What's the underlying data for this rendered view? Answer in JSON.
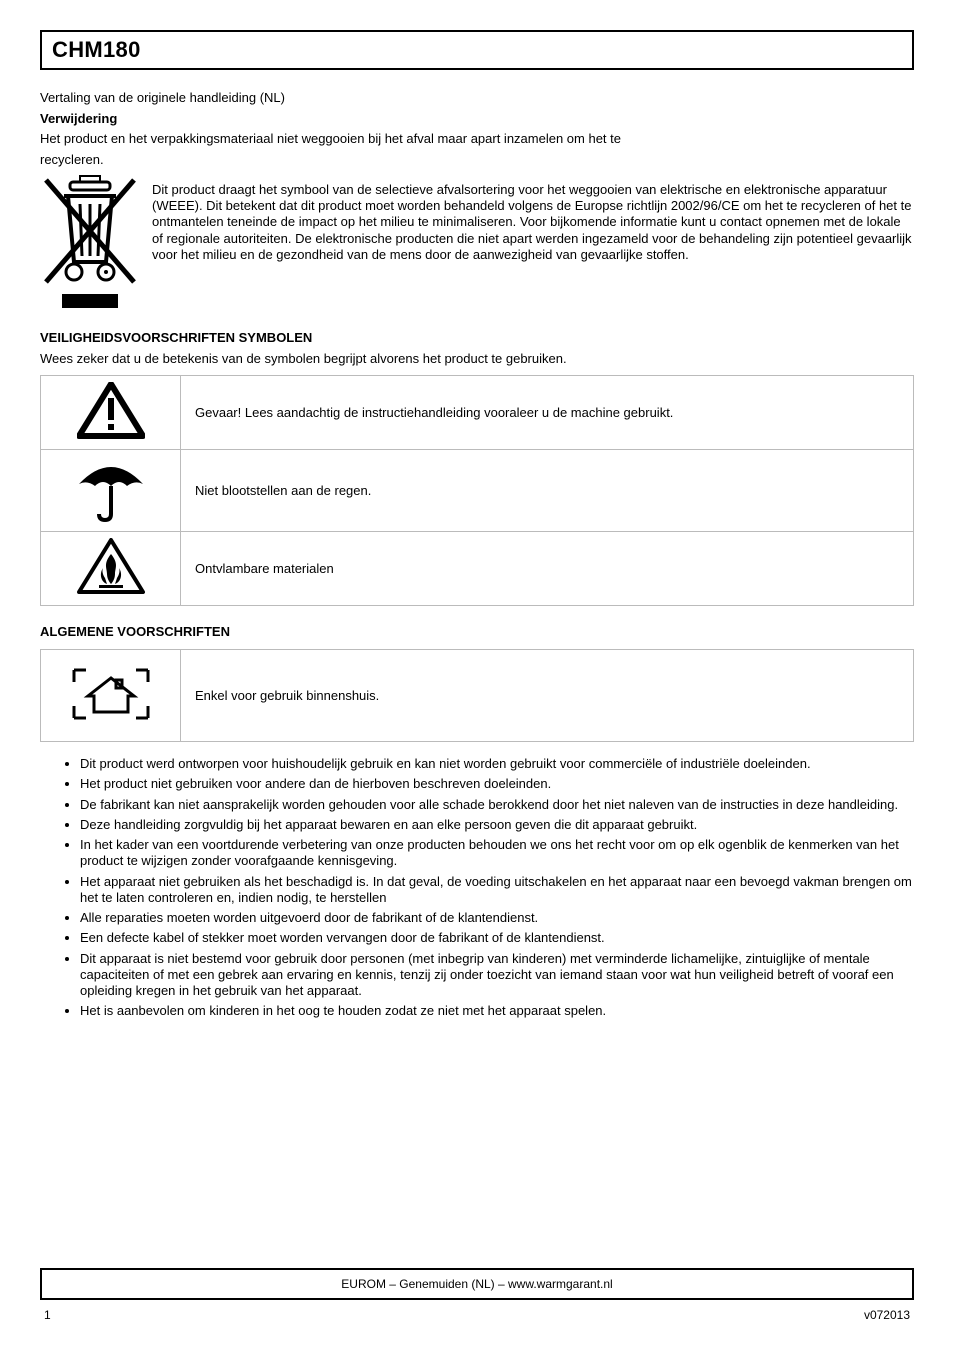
{
  "title_bar": "CHM180",
  "lang_header": "Vertaling van de originele handleiding (NL)",
  "disposal_heading": "Verwijdering",
  "disposal_line1": "Het product en het verpakkingsmateriaal niet weggooien bij het afval maar apart inzamelen om het te",
  "disposal_line2": "recycleren.",
  "disposal_para": "Dit product draagt het symbool van de selectieve afvalsortering voor het weggooien van elektrische en elektronische apparatuur (WEEE). Dit betekent dat dit product moet worden behandeld volgens de Europse richtlijn 2002/96/CE om het te recycleren of het te ontmantelen teneinde de impact op het milieu te minimaliseren. Voor bijkomende informatie kunt u contact opnemen met de lokale of regionale autoriteiten. De elektronische producten die niet apart werden ingezameld voor de behandeling zijn potentieel gevaarlijk voor het milieu en de gezondheid van de mens door de aanwezigheid van gevaarlijke stoffen.",
  "safety_heading": "VEILIGHEIDSVOORSCHRIFTEN SYMBOLEN",
  "safety_intro": "Wees zeker dat u de betekenis van de symbolen begrijpt alvorens het product te gebruiken.",
  "symbols": {
    "warning": "Gevaar! Lees aandachtig de instructiehandleiding vooraleer u de machine gebruikt.",
    "umbrella": "Niet blootstellen aan de regen.",
    "fire": "Ontvlambare materialen"
  },
  "general_heading": "ALGEMENE VOORSCHRIFTEN",
  "indoor_label": "Enkel voor gebruik binnenshuis.",
  "bullets": [
    "Dit product werd ontworpen voor huishoudelijk gebruik en kan niet worden gebruikt voor commerciële of industriële doeleinden.",
    "Het product niet gebruiken voor andere dan de hierboven beschreven doeleinden.",
    "De fabrikant kan niet aansprakelijk worden gehouden voor alle schade berokkend door het niet naleven van de instructies in deze handleiding.",
    "Deze handleiding zorgvuldig bij het apparaat bewaren en aan elke persoon geven die dit apparaat gebruikt.",
    "In het kader van een voortdurende verbetering van onze producten behouden we ons het recht voor om op elk ogenblik de kenmerken van het product te wijzigen zonder voorafgaande kennisgeving.",
    "Het apparaat niet gebruiken als het beschadigd is. In dat geval, de voeding uitschakelen en het apparaat naar een bevoegd vakman brengen om het te laten controleren en, indien nodig, te herstellen",
    "Alle reparaties moeten worden uitgevoerd door de fabrikant of de klantendienst.",
    "Een defecte kabel of stekker moet worden vervangen door de fabrikant of de klantendienst.",
    "Dit apparaat is niet bestemd voor gebruik door personen (met inbegrip van kinderen) met verminderde lichamelijke, zintuiglijke of mentale capaciteiten of met een gebrek aan ervaring en kennis, tenzij zij onder toezicht van iemand staan voor wat hun veiligheid betreft of vooraf een opleiding kregen in het gebruik van het apparaat.",
    "Het is aanbevolen om kinderen in het oog te houden zodat ze niet met het apparaat spelen."
  ],
  "footer_bar": "EUROM – Genemuiden (NL) – www.warmgarant.nl",
  "footer": {
    "left": "1",
    "right": "v072013"
  }
}
